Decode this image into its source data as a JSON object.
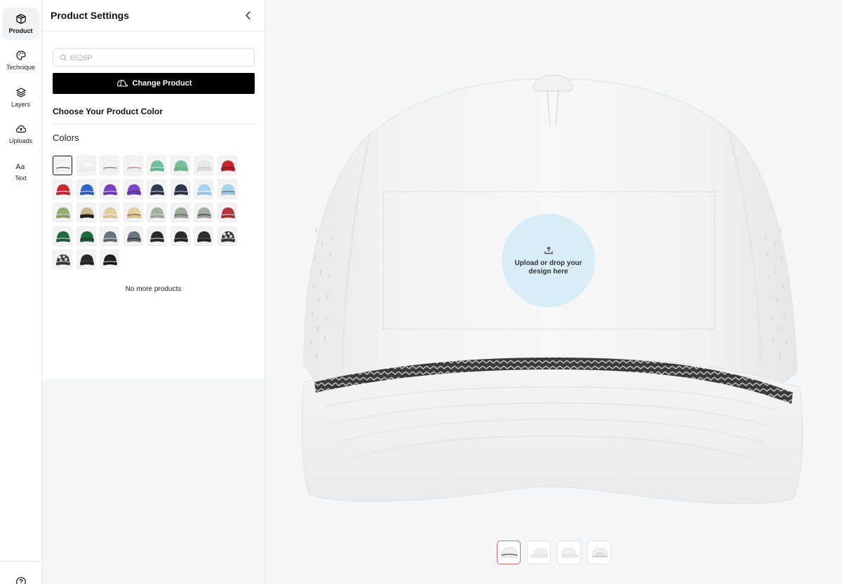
{
  "rail": {
    "items": [
      {
        "label": "Product",
        "icon": "box-icon",
        "active": true
      },
      {
        "label": "Technique",
        "icon": "palette-icon",
        "active": false
      },
      {
        "label": "Layers",
        "icon": "layers-icon",
        "active": false
      },
      {
        "label": "Uploads",
        "icon": "cloud-upload-icon",
        "active": false
      },
      {
        "label": "Text",
        "icon": "text-icon",
        "active": false
      }
    ],
    "help_icon": "help-circle-icon"
  },
  "panel": {
    "title": "Product Settings",
    "search": {
      "placeholder": "6526P"
    },
    "change_button": "Change Product",
    "color_heading": "Choose Your Product Color",
    "colors_label": "Colors",
    "no_more": "No more products",
    "swatches": [
      {
        "crown": "#f7f7f7",
        "visor": "#f2f2f2",
        "rope": "#222222",
        "selected": true
      },
      {
        "crown": "#f3f3f3",
        "visor": "#eeeeee",
        "rope": "#e6e6e6"
      },
      {
        "crown": "#f6f6f6",
        "visor": "#f0f0f0",
        "rope": "#555555"
      },
      {
        "crown": "#f7f7f7",
        "visor": "#f0f0f0",
        "rope": "#c94a52"
      },
      {
        "crown": "#6bbf9c",
        "visor": "#5fb090",
        "rope": "#e8e8e8"
      },
      {
        "crown": "#74c3a0",
        "visor": "#66b592",
        "rope": "#b88b4a"
      },
      {
        "crown": "#e9e9e9",
        "visor": "#dddddd",
        "rope": "#bbbbbb"
      },
      {
        "crown": "#c8262f",
        "visor": "#b51f28",
        "rope": "#222222"
      },
      {
        "crown": "#d0262e",
        "visor": "#c01f28",
        "rope": "#f0f0f0"
      },
      {
        "crown": "#2f66c8",
        "visor": "#2758b2",
        "rope": "#dddddd"
      },
      {
        "crown": "#7a3fc4",
        "visor": "#6b34b0",
        "rope": "#dddddd"
      },
      {
        "crown": "#7c44c6",
        "visor": "#6c38b2",
        "rope": "#444444"
      },
      {
        "crown": "#2e3a4d",
        "visor": "#26303f",
        "rope": "#cccccc"
      },
      {
        "crown": "#2a3550",
        "visor": "#222c44",
        "rope": "#b8b8b8"
      },
      {
        "crown": "#a8d2ef",
        "visor": "#98c5e6",
        "rope": "#ffffff"
      },
      {
        "crown": "#a9d4f0",
        "visor": "#9ac7e7",
        "rope": "#555555"
      },
      {
        "crown": "#97ac6f",
        "visor": "#869c60",
        "rope": "#dddddd"
      },
      {
        "crown": "#c9b791",
        "visor": "#1d1d1d",
        "rope": "#333333"
      },
      {
        "crown": "#e3cf9e",
        "visor": "#d8c28f",
        "rope": "#ffffff"
      },
      {
        "crown": "#e6cf98",
        "visor": "#dbc189",
        "rope": "#555555"
      },
      {
        "crown": "#a9aea6",
        "visor": "#9aa098",
        "rope": "#dddddd"
      },
      {
        "crown": "#a3aba0",
        "visor": "#959d92",
        "rope": "#555555"
      },
      {
        "crown": "#a7ada4",
        "visor": "#989e95",
        "rope": "#222222"
      },
      {
        "crown": "#b5353a",
        "visor": "#a52d32",
        "rope": "#dddddd"
      },
      {
        "crown": "#1f6a3f",
        "visor": "#195a35",
        "rope": "#dddddd"
      },
      {
        "crown": "#1e6b40",
        "visor": "#175934",
        "rope": "#222222"
      },
      {
        "crown": "#67747b",
        "visor": "#5a666c",
        "rope": "#dddddd"
      },
      {
        "crown": "#6a777e",
        "visor": "#5c686e",
        "rope": "#222222"
      },
      {
        "crown": "#2b2b2b",
        "visor": "#222222",
        "rope": "#dddddd"
      },
      {
        "crown": "#2a2a2a",
        "visor": "#202020",
        "rope": "#8a8a8a"
      },
      {
        "crown": "#2d2d2d",
        "visor": "#232323",
        "rope": "#555555"
      },
      {
        "crown": "#3a3a3a",
        "visor": "#333333",
        "rope": "#cccccc",
        "camo": true
      },
      {
        "crown": "#3c3c3c",
        "visor": "#333333",
        "rope": "#cccccc",
        "camo": true
      },
      {
        "crown": "#2a2a2a",
        "visor": "#222222",
        "rope": "#444444"
      },
      {
        "crown": "#1f1f1f",
        "visor": "#171717",
        "rope": "#dddddd"
      }
    ]
  },
  "canvas": {
    "upload_text": "Upload or drop your design here",
    "upload_bg": "#d8ecf6",
    "thumbnails": [
      {
        "view": "front",
        "active": true
      },
      {
        "view": "left",
        "active": false
      },
      {
        "view": "right",
        "active": false
      },
      {
        "view": "back",
        "active": false
      }
    ],
    "active_thumb_border": "#d96b6b"
  }
}
